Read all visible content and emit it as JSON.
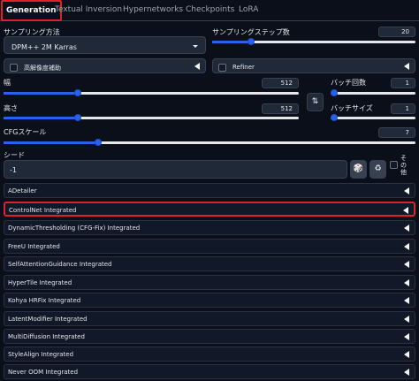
{
  "tabs": [
    {
      "label": "Generation",
      "active": true
    },
    {
      "label": "Textual Inversion"
    },
    {
      "label": "Hypernetworks"
    },
    {
      "label": "Checkpoints"
    },
    {
      "label": "LoRA"
    }
  ],
  "sampler": {
    "label": "サンプリング方法",
    "value": "DPM++ 2M Karras"
  },
  "steps": {
    "label": "サンプリングステップ数",
    "value": "20",
    "fraction": 0.19
  },
  "hires": {
    "label": "高解像度補助"
  },
  "refiner": {
    "label": "Refiner"
  },
  "width": {
    "label": "幅",
    "value": "512",
    "fraction": 0.25
  },
  "height": {
    "label": "高さ",
    "value": "512",
    "fraction": 0.25
  },
  "swap_icon": "⇅",
  "batch_count": {
    "label": "バッチ回数",
    "value": "1",
    "fraction": 0.0
  },
  "batch_size": {
    "label": "バッチサイズ",
    "value": "1",
    "fraction": 0.0
  },
  "cfg": {
    "label": "CFGスケール",
    "value": "7",
    "fraction": 0.23
  },
  "seed": {
    "label": "シード",
    "value": "-1",
    "dice_icon": "🎲",
    "recycle_icon": "♻",
    "extra_label": "その他"
  },
  "accordions": [
    {
      "label": "ADetailer",
      "highlight": false
    },
    {
      "label": "ControlNet Integrated",
      "highlight": true
    },
    {
      "label": "DynamicThresholding (CFG-Fix) Integrated",
      "highlight": false
    },
    {
      "label": "FreeU Integrated",
      "highlight": false
    },
    {
      "label": "SelfAttentionGuidance Integrated",
      "highlight": false
    },
    {
      "label": "HyperTile Integrated",
      "highlight": false
    },
    {
      "label": "Kohya HRFix Integrated",
      "highlight": false
    },
    {
      "label": "LatentModifier Integrated",
      "highlight": false
    },
    {
      "label": "MultiDiffusion Integrated",
      "highlight": false
    },
    {
      "label": "StyleAlign Integrated",
      "highlight": false
    },
    {
      "label": "Never OOM Integrated",
      "highlight": false
    }
  ],
  "colors": {
    "accent": "#2563eb",
    "highlight": "#e0202a",
    "background": "#0b0f19"
  }
}
